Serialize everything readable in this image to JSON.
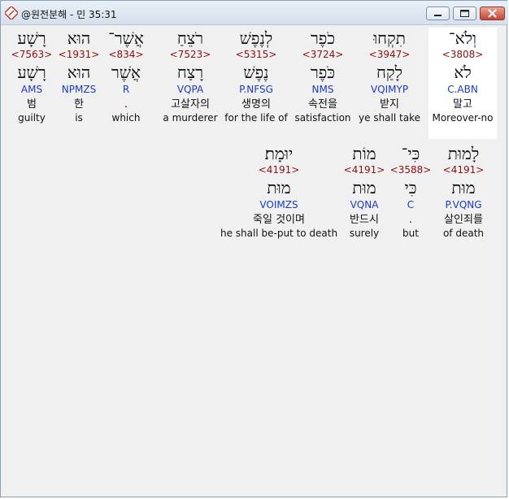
{
  "window": {
    "title": "@원전분해 - 민 35:31"
  },
  "colors": {
    "strong": "#8b1010",
    "morph": "#1a3bbf",
    "selected_bg": "#ffffff"
  },
  "row1": [
    {
      "heb": "וְלֹא־",
      "strong": "<3808>",
      "lemma": "לֹא",
      "morph": "C.ABN",
      "kor": "말고",
      "eng": "Moreover-no",
      "selected": true
    },
    {
      "heb": "תִקְחוּ",
      "strong": "<3947>",
      "lemma": "לָקַח",
      "morph": "VQIMYP",
      "kor": "받지",
      "eng": "ye shall take"
    },
    {
      "heb": "כֹפֶר",
      "strong": "<3724>",
      "lemma": "כֹּפֶר",
      "morph": "NMS",
      "kor": "속전을",
      "eng": "satisfaction"
    },
    {
      "heb": "לְנֶפֶשׁ",
      "strong": "<5315>",
      "lemma": "נֶפֶשׁ",
      "morph": "P.NFSG",
      "kor": "생명의",
      "eng": "for the life of"
    },
    {
      "heb": "רֹצֵחַ",
      "strong": "<7523>",
      "lemma": "רָצַח",
      "morph": "VQPA",
      "kor": "고살자의",
      "eng": "a murderer"
    },
    {
      "heb": "אֲשֶׁר־",
      "strong": "<834>",
      "lemma": "אֲשֶׁר",
      "morph": "R",
      "kor": ".",
      "eng": "which"
    },
    {
      "heb": "הוּא",
      "strong": "<1931>",
      "lemma": "הוּא",
      "morph": "NPMZS",
      "kor": "한",
      "eng": "is"
    },
    {
      "heb": "רָשָׁע",
      "strong": "<7563>",
      "lemma": "רָשָׁע",
      "morph": "AMS",
      "kor": "범",
      "eng": "guilty"
    }
  ],
  "row2": [
    {
      "heb": "לָמוּת",
      "strong": "<4191>",
      "lemma": "מוּת",
      "morph": "P.VQNG",
      "kor": "살인죄를",
      "eng": "of death"
    },
    {
      "heb": "כִּי־",
      "strong": "<3588>",
      "lemma": "כִּי",
      "morph": "C",
      "kor": ".",
      "eng": "but"
    },
    {
      "heb": "מוֹת",
      "strong": "<4191>",
      "lemma": "מוּת",
      "morph": "VQNA",
      "kor": "반드시",
      "eng": "surely"
    },
    {
      "heb": "יוּמָת׃",
      "strong": "<4191>",
      "lemma": "מוּת",
      "morph": "VOIMZS",
      "kor": "죽일 것이며",
      "eng": "he shall be-put to death"
    }
  ]
}
